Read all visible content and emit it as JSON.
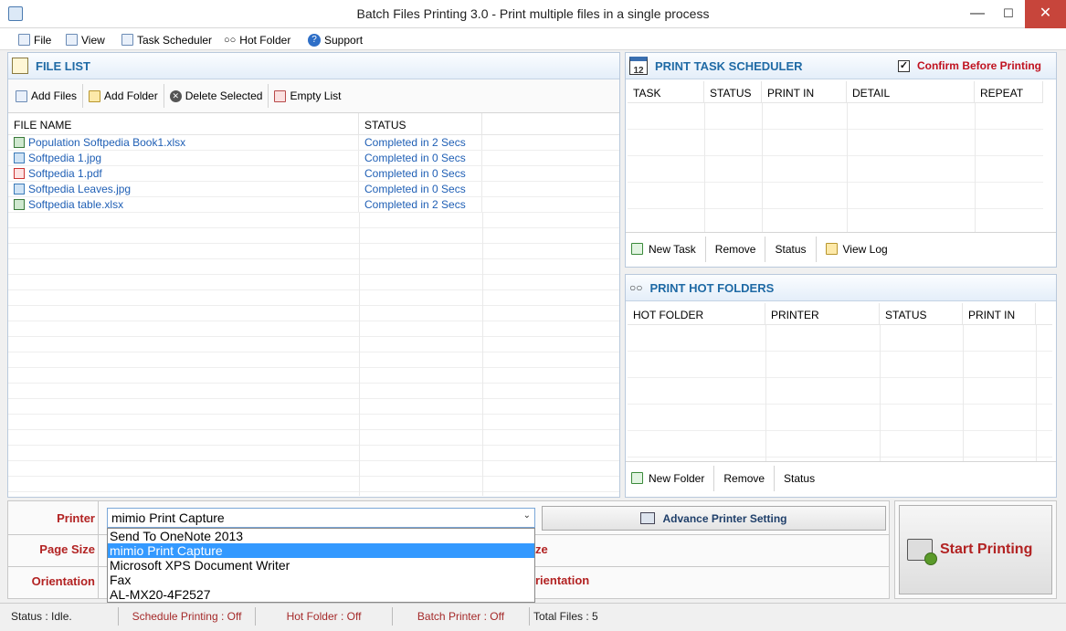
{
  "window": {
    "title": "Batch Files Printing 3.0 - Print multiple files in a single process",
    "min": "—",
    "max": "☐",
    "close": "✕"
  },
  "menu": [
    {
      "label": "File"
    },
    {
      "label": "View"
    },
    {
      "label": "Task Scheduler"
    },
    {
      "label": "Hot Folder"
    },
    {
      "label": "Support"
    }
  ],
  "file_list": {
    "title": "FILE LIST",
    "toolbar": {
      "add_files": "Add Files",
      "add_folder": "Add Folder",
      "delete_selected": "Delete Selected",
      "empty_list": "Empty List"
    },
    "columns": [
      "FILE NAME",
      "STATUS"
    ],
    "rows": [
      {
        "name": "Population Softpedia Book1.xlsx",
        "status": "Completed in 2 Secs",
        "icon": "xlsx-icon"
      },
      {
        "name": "Softpedia 1.jpg",
        "status": "Completed in 0 Secs",
        "icon": "jpg-icon"
      },
      {
        "name": "Softpedia 1.pdf",
        "status": "Completed in 0 Secs",
        "icon": "pdf-icon"
      },
      {
        "name": "Softpedia Leaves.jpg",
        "status": "Completed in 0 Secs",
        "icon": "jpg-icon"
      },
      {
        "name": "Softpedia table.xlsx",
        "status": "Completed in 2 Secs",
        "icon": "xlsx-icon"
      }
    ]
  },
  "scheduler": {
    "title": "PRINT TASK SCHEDULER",
    "calendar_day": "12",
    "confirm_label": "Confirm Before Printing",
    "confirm_checked": true,
    "columns": [
      "TASK",
      "STATUS",
      "PRINT IN",
      "DETAIL",
      "REPEAT"
    ],
    "buttons": {
      "new_task": "New Task",
      "remove": "Remove",
      "status": "Status",
      "view_log": "View Log"
    }
  },
  "hot_folders": {
    "title": "PRINT HOT FOLDERS",
    "columns": [
      "HOT FOLDER",
      "PRINTER",
      "STATUS",
      "PRINT IN"
    ],
    "buttons": {
      "new_folder": "New Folder",
      "remove": "Remove",
      "status": "Status"
    }
  },
  "settings": {
    "printer_label": "Printer",
    "page_size_label": "Page Size",
    "orientation_label": "Orientation",
    "printer_selected": "mimio Print Capture",
    "printer_options": [
      "Send To OneNote 2013",
      "mimio Print Capture",
      "Microsoft XPS Document Writer",
      "Fax",
      "AL-MX20-4F2527"
    ],
    "advance_button": "Advance Printer Setting",
    "hidden_size_tail": "ze",
    "hidden_orientation_tail": "rientation"
  },
  "start_button": "Start Printing",
  "status_bar": {
    "status": "Status :  Idle.",
    "schedule": "Schedule Printing : Off",
    "hot_folder": "Hot Folder : Off",
    "batch_printer": "Batch Printer : Off",
    "total_files": "Total Files :   5"
  },
  "colors": {
    "accent": "#1f6aa5",
    "label_red": "#b22222",
    "selection": "#3399ff"
  }
}
